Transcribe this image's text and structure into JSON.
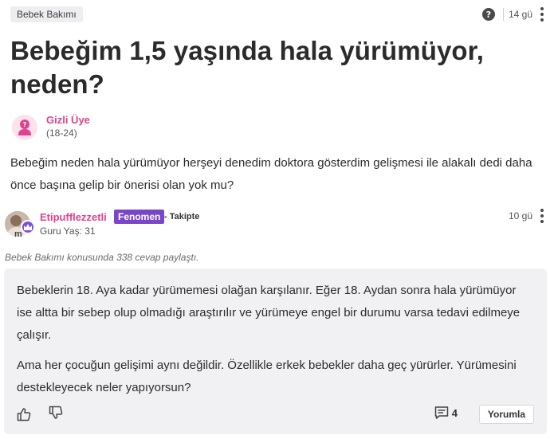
{
  "topbar": {
    "category": "Bebek Bakımı",
    "help_icon": "question-circle-icon",
    "help_glyph": "?",
    "time": "14 gü",
    "more_icon": "vertical-dots-icon"
  },
  "question": {
    "title": "Bebeğim 1,5 yaşında hala yürümüyor, neden?",
    "body": "Bebeğim neden hala yürümüyor herşeyi denedim doktora gösterdim gelişmesi ile alakalı dedi daha önce başına gelip bir önerisi olan yok mu?"
  },
  "asker": {
    "name": "Gizli Üye",
    "age": "(18-24)",
    "avatar_icon": "anonymous-user-icon"
  },
  "answer": {
    "author": "Etipufflezzetli",
    "avatar_letter": "m",
    "level_badge": "Fenomen",
    "follow": "- Takipte",
    "guru": "Guru Yaş: 31",
    "time": "10 gü",
    "share_note": "Bebek Bakımı konusunda 338 cevap paylaştı.",
    "paragraph1": "Bebeklerin 18. Aya kadar yürümemesi olağan karşılanır. Eğer 18. Aydan sonra hala yürümüyor ise altta bir sebep olup olmadığı araştırılır ve yürümeye engel bir durumu varsa tedavi edilmeye çalışır.",
    "paragraph2": "Ama her çocuğun gelişimi aynı değildir. Özellikle erkek bebekler daha geç yürürler. Yürümesini destekleyecek neler yapıyorsun?",
    "comment_count": "4",
    "reply_label": "Yorumla"
  },
  "colors": {
    "username_pink": "#e2418b",
    "badge_purple": "#7a46c9",
    "card_bg": "#f1f1f3",
    "text": "#2b2b2b"
  }
}
